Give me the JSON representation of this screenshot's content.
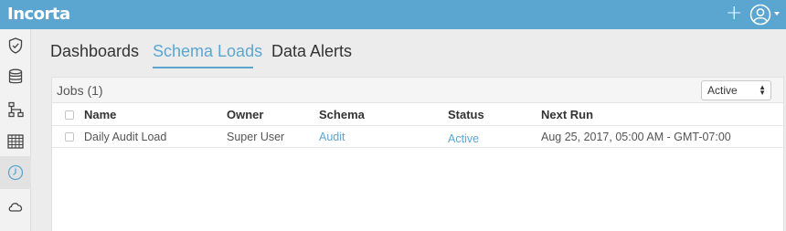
{
  "app": {
    "logo_text": "Incorta"
  },
  "topbar": {
    "add_icon": "plus-icon",
    "user_icon": "user-avatar-icon"
  },
  "sidebar": {
    "items": [
      {
        "icon": "shield-check-icon",
        "label": ""
      },
      {
        "icon": "database-icon",
        "label": ""
      },
      {
        "icon": "hierarchy-icon",
        "label": ""
      },
      {
        "icon": "grid-table-icon",
        "label": ""
      },
      {
        "icon": "clock-icon",
        "label": "",
        "active": true
      },
      {
        "icon": "cloud-icon",
        "label": ""
      }
    ]
  },
  "tabs": [
    {
      "label": "Dashboards"
    },
    {
      "label": "Schema Loads",
      "active": true
    },
    {
      "label": "Data Alerts"
    }
  ],
  "jobs": {
    "title": "Jobs (1)",
    "filter": {
      "selected": "Active"
    },
    "columns": [
      "Name",
      "Owner",
      "Schema",
      "Status",
      "Next Run"
    ],
    "rows": [
      {
        "name": "Daily Audit Load",
        "owner": "Super User",
        "schema": "Audit",
        "status": "Active",
        "next_run": "Aug 25, 2017, 05:00 AM - GMT-07:00"
      }
    ]
  },
  "colors": {
    "accent": "#5ba6d1",
    "topbar": "#5ba6d1"
  }
}
